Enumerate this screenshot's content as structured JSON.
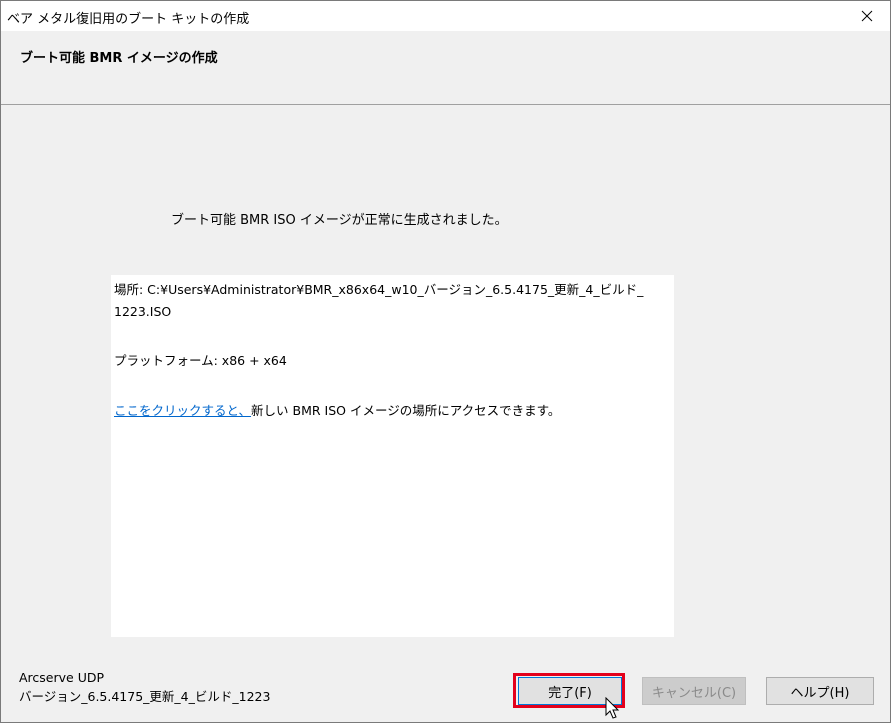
{
  "window": {
    "title": "ベア メタル復旧用のブート キットの作成",
    "close_symbol": "✕"
  },
  "header": {
    "title": "ブート可能 BMR イメージの作成"
  },
  "content": {
    "success_message": "ブート可能 BMR ISO イメージが正常に生成されました。",
    "location_line1": "場所: C:¥Users¥Administrator¥BMR_x86x64_w10_バージョン_6.5.4175_更新_4_ビルド_",
    "location_line2": "1223.ISO",
    "platform": "プラットフォーム: x86 + x64",
    "link_text": "ここをクリックすると、",
    "link_suffix": "新しい BMR ISO イメージの場所にアクセスできます。"
  },
  "footer": {
    "product": "Arcserve UDP",
    "version": "バージョン_6.5.4175_更新_4_ビルド_1223"
  },
  "buttons": {
    "finish": "完了(F)",
    "cancel": "キャンセル(C)",
    "help": "ヘルプ(H)"
  },
  "colors": {
    "highlight": "#e3001b",
    "link": "#0066cc",
    "focus": "#0078d7"
  }
}
